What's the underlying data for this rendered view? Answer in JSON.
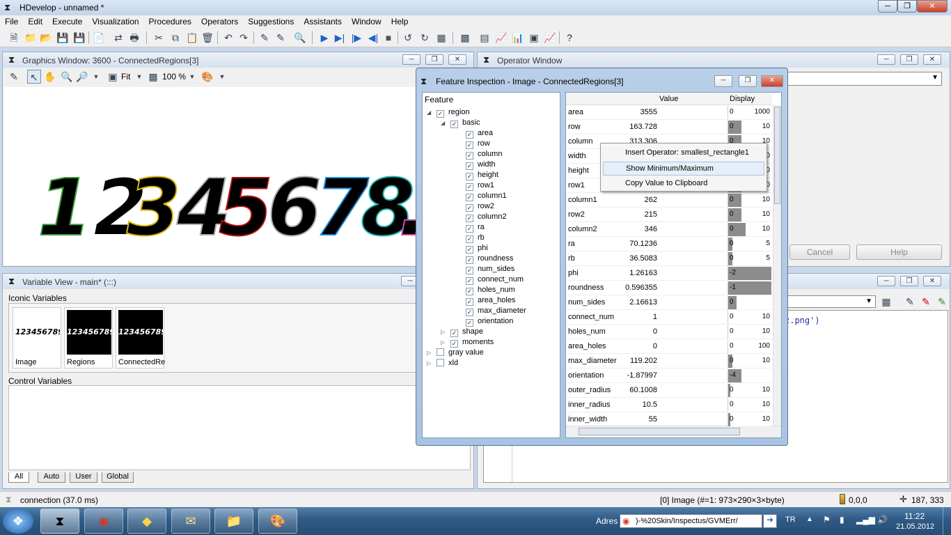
{
  "app": {
    "title": "HDevelop - unnamed *"
  },
  "menu": [
    "File",
    "Edit",
    "Execute",
    "Visualization",
    "Procedures",
    "Operators",
    "Suggestions",
    "Assistants",
    "Window",
    "Help"
  ],
  "graphics": {
    "title": "Graphics Window: 3600 - ConnectedRegions[3]",
    "fit": "Fit",
    "zoom": "100 %",
    "digits": [
      "1",
      "2",
      "3",
      "4",
      "5",
      "6",
      "7",
      "8",
      "."
    ],
    "digit_colors": [
      "#3a9a3a",
      "#ffffff",
      "#d8b800",
      "#b0b0b0",
      "#b01010",
      "#aaaaaa",
      "#1e8dd8",
      "#20b8b0",
      "#d84aa8"
    ]
  },
  "variable_view": {
    "title": "Variable View - main* (:::)",
    "iconic_label": "Iconic Variables",
    "control_label": "Control Variables",
    "thumb_text": "123456789",
    "items": [
      {
        "name": "Image"
      },
      {
        "name": "Regions"
      },
      {
        "name": "ConnectedRe"
      }
    ],
    "tabs": [
      "All",
      "Auto",
      "User",
      "Global"
    ]
  },
  "operator_window": {
    "title": "Operator Window",
    "cancel": "Cancel",
    "help": "Help",
    "code_snippet": "z.png')"
  },
  "feature": {
    "title": "Feature Inspection - Image - ConnectedRegions[3]",
    "tree_header": "Feature",
    "tree": {
      "region": "region",
      "basic": "basic",
      "basic_items": [
        "area",
        "row",
        "column",
        "width",
        "height",
        "row1",
        "column1",
        "row2",
        "column2",
        "ra",
        "rb",
        "phi",
        "roundness",
        "num_sides",
        "connect_num",
        "holes_num",
        "area_holes",
        "max_diameter",
        "orientation"
      ],
      "shape": "shape",
      "moments": "moments",
      "gray": "gray value",
      "xld": "xld"
    },
    "col_value": "Value",
    "col_display": "Display",
    "rows": [
      {
        "name": "area",
        "value": "3555",
        "lo": "0",
        "hi": "1000",
        "fill": 0
      },
      {
        "name": "row",
        "value": "163.728",
        "lo": "0",
        "hi": "10",
        "fill": 0.3
      },
      {
        "name": "column",
        "value": "313.306",
        "lo": "0",
        "hi": "10",
        "fill": 0.3
      },
      {
        "name": "width",
        "value": "",
        "lo": "0",
        "hi": "10",
        "fill": 0.3
      },
      {
        "name": "height",
        "value": "",
        "lo": "0",
        "hi": "10",
        "fill": 0.3
      },
      {
        "name": "row1",
        "value": "",
        "lo": "0",
        "hi": "10",
        "fill": 0.3
      },
      {
        "name": "column1",
        "value": "262",
        "lo": "0",
        "hi": "10",
        "fill": 0.3
      },
      {
        "name": "row2",
        "value": "215",
        "lo": "0",
        "hi": "10",
        "fill": 0.3
      },
      {
        "name": "column2",
        "value": "346",
        "lo": "0",
        "hi": "10",
        "fill": 0.4
      },
      {
        "name": "ra",
        "value": "70.1236",
        "lo": "0",
        "hi": "5",
        "fill": 0.1
      },
      {
        "name": "rb",
        "value": "36.5083",
        "lo": "0",
        "hi": "5",
        "fill": 0.1
      },
      {
        "name": "phi",
        "value": "1.26163",
        "lo": "-2",
        "hi": "",
        "fill": 1
      },
      {
        "name": "roundness",
        "value": "0.596355",
        "lo": "-1",
        "hi": "",
        "fill": 1
      },
      {
        "name": "num_sides",
        "value": "2.16613",
        "lo": "0",
        "hi": "",
        "fill": 0.2
      },
      {
        "name": "connect_num",
        "value": "1",
        "lo": "0",
        "hi": "10",
        "fill": 0
      },
      {
        "name": "holes_num",
        "value": "0",
        "lo": "0",
        "hi": "10",
        "fill": 0
      },
      {
        "name": "area_holes",
        "value": "0",
        "lo": "0",
        "hi": "100",
        "fill": 0
      },
      {
        "name": "max_diameter",
        "value": "119.202",
        "lo": "0",
        "hi": "10",
        "fill": 0.1
      },
      {
        "name": "orientation",
        "value": "-1.87997",
        "lo": "-4",
        "hi": "",
        "fill": 0.3
      },
      {
        "name": "outer_radius",
        "value": "60.1008",
        "lo": "0",
        "hi": "10",
        "fill": 0.05
      },
      {
        "name": "inner_radius",
        "value": "10.5",
        "lo": "0",
        "hi": "10",
        "fill": 0
      },
      {
        "name": "inner_width",
        "value": "55",
        "lo": "0",
        "hi": "10",
        "fill": 0.05
      }
    ],
    "menu": [
      "Insert Operator: smallest_rectangle1",
      "Show Minimum/Maximum",
      "Copy Value to Clipboard"
    ]
  },
  "status": {
    "left": "connection (37.0 ms)",
    "image": "[0] Image (#=1: 973×290×3×byte)",
    "gray": "0,0,0",
    "coords": "187, 333"
  },
  "taskbar": {
    "address_label": "Adres",
    "address": ")-%20Skin/Inspectus/GVMErr/",
    "lang": "TR",
    "time": "11:22",
    "date": "21.05.2012"
  }
}
